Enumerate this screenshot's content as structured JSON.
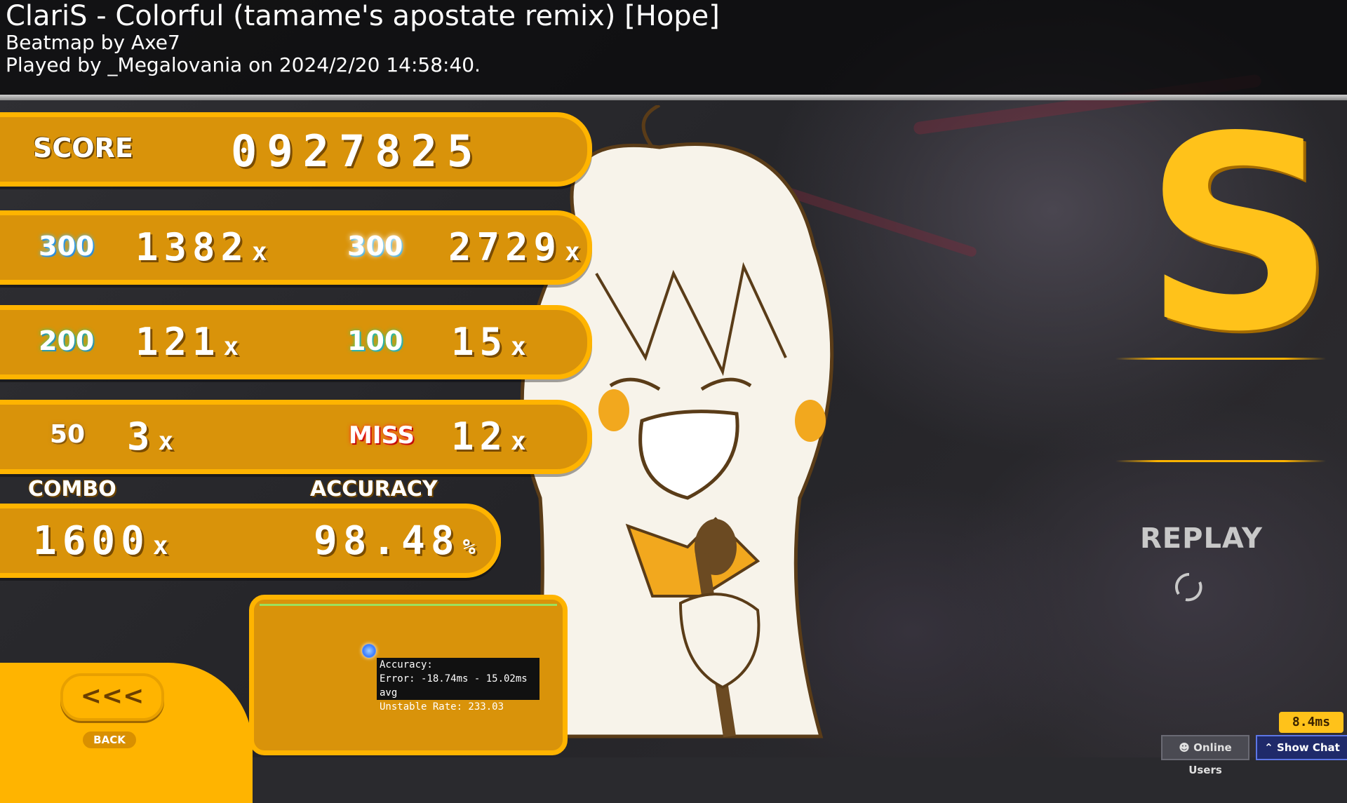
{
  "header": {
    "title": "ClariS - Colorful (tamame's apostate remix) [Hope]",
    "beatmap": "Beatmap by Axe7",
    "played": "Played by _Megalovania on 2024/2/20 14:58:40."
  },
  "score": {
    "label": "SCORE",
    "value": "0927825"
  },
  "hits": {
    "h300": {
      "icon": "300",
      "count": "1382"
    },
    "geki": {
      "icon": "300",
      "count": "2729"
    },
    "katu": {
      "icon": "200",
      "count": "121"
    },
    "h100": {
      "icon": "100",
      "count": "15"
    },
    "h50": {
      "icon": "50",
      "count": "3"
    },
    "miss": {
      "icon": "MISS",
      "count": "12"
    },
    "x_suffix": "x"
  },
  "combo": {
    "label": "COMBO",
    "value": "1600",
    "suffix": "x"
  },
  "accuracy": {
    "label": "ACCURACY",
    "value": "98.48",
    "suffix": "%"
  },
  "tooltip": {
    "line1": "Accuracy:",
    "line2": "Error: -18.74ms - 15.02ms avg",
    "line3": "Unstable Rate: 233.03"
  },
  "back": {
    "arrows": "<<<",
    "label": "BACK"
  },
  "rank": "S",
  "replay": "REPLAY",
  "ping": "8.4ms",
  "footer": {
    "online_users": "Online Users",
    "show_chat": "Show Chat"
  },
  "colors": {
    "accent": "#ffb400",
    "bar_fill": "#d9930a",
    "rank": "#ffc21a"
  }
}
